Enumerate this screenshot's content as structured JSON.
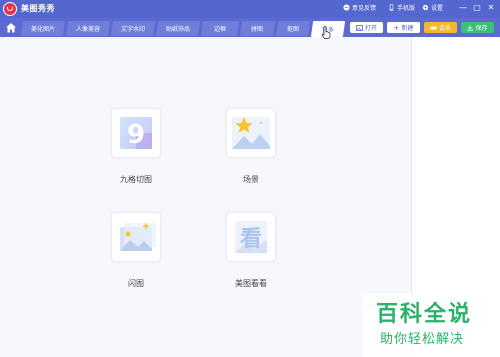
{
  "app": {
    "title": "美图秀秀"
  },
  "titlebar": {
    "feedback": "意见反馈",
    "mobile": "手机版",
    "settings": "设置",
    "minimize": "—",
    "restore": "□",
    "close": "✕"
  },
  "tabs": [
    {
      "label": "美化图片"
    },
    {
      "label": "人像美容"
    },
    {
      "label": "文字水印"
    },
    {
      "label": "贴纸饰品"
    },
    {
      "label": "边框"
    },
    {
      "label": "拼图"
    },
    {
      "label": "抠图"
    },
    {
      "label": "更多"
    }
  ],
  "toolbar": {
    "open": "打开",
    "new": "新建",
    "vip": "会员",
    "save": "保存"
  },
  "tools": [
    {
      "label": "九格切图",
      "glyph": "9"
    },
    {
      "label": "场景"
    },
    {
      "label": "闪图"
    },
    {
      "label": "美图看看",
      "glyph": "看"
    }
  ],
  "watermark": {
    "title": "百科全说",
    "subtitle": "助你轻松解决"
  },
  "colors": {
    "brand": "#5466cf",
    "vip": "#f6b82a",
    "save": "#3cbf7b",
    "logo": "#e8334a"
  }
}
